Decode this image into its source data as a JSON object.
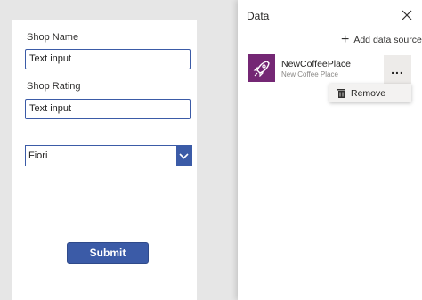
{
  "form": {
    "shop_name_label": "Shop Name",
    "shop_name_value": "Text input",
    "shop_rating_label": "Shop Rating",
    "shop_rating_value": "Text input",
    "dropdown_value": "Fiori",
    "submit_label": "Submit"
  },
  "data_pane": {
    "title": "Data",
    "add_source_label": "Add data source",
    "sources": [
      {
        "name": "NewCoffeePlace",
        "subtitle": "New Coffee Place",
        "icon": "rocket-icon"
      }
    ],
    "more_label": "...",
    "context_menu": {
      "remove_label": "Remove",
      "icon": "trash-icon"
    }
  },
  "colors": {
    "accent": "#3b5ba7",
    "source_logo": "#742774",
    "canvas_bg": "#e6e6e6"
  }
}
